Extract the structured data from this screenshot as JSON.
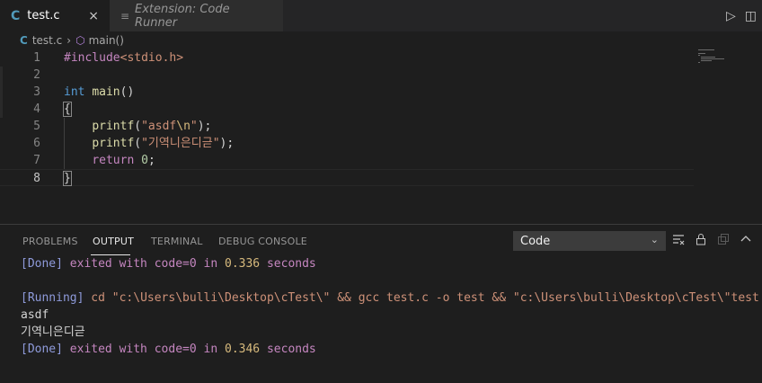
{
  "tabs": [
    {
      "label": "test.c",
      "icon": "c-file-icon",
      "icon_glyph": "C",
      "active": true,
      "close": "×"
    },
    {
      "label": "Extension: Code Runner",
      "icon": "preview-icon",
      "icon_glyph": "≡",
      "active": false
    }
  ],
  "tab_actions": {
    "run_glyph": "▷",
    "split_glyph": "◫"
  },
  "breadcrumb": {
    "file": "test.c",
    "file_glyph": "C",
    "symbol": "main()",
    "symbol_glyph": "⬡",
    "sep": "›"
  },
  "editor": {
    "line_numbers": [
      "1",
      "2",
      "3",
      "4",
      "5",
      "6",
      "7",
      "8"
    ],
    "lines": {
      "l1": {
        "pp": "#include",
        "hdr": "<stdio.h>"
      },
      "l3": {
        "kw": "int",
        "fn": "main",
        "rest": "()"
      },
      "l4": {
        "brace": "{"
      },
      "l5": {
        "indent": "    ",
        "fn": "printf",
        "open": "(",
        "str1": "\"asdf",
        "esc": "\\n",
        "str2": "\"",
        "close": ");"
      },
      "l6": {
        "indent": "    ",
        "fn": "printf",
        "open": "(",
        "str": "\"기역니은디귿\"",
        "close": ");"
      },
      "l7": {
        "indent": "    ",
        "kw": "return",
        "sp": " ",
        "num": "0",
        "end": ";"
      },
      "l8": {
        "brace": "}"
      }
    }
  },
  "panel": {
    "tabs": [
      "PROBLEMS",
      "OUTPUT",
      "TERMINAL",
      "DEBUG CONSOLE"
    ],
    "active_tab": "OUTPUT",
    "channel": "Code",
    "chev": "⌄",
    "acts": {
      "clear": "≡̶",
      "lock": "🔒︎",
      "copy": "⧉",
      "maximize": "^"
    },
    "output": {
      "done1": {
        "tag": "[Done]",
        "text": " exited with ",
        "code": "code=0",
        "in": " in ",
        "num": "0.336",
        "sec": " seconds"
      },
      "running": {
        "tag": "[Running]",
        "cmd": " cd \"c:\\Users\\bulli\\Desktop\\cTest\\\" && gcc test.c -o test && \"c:\\Users\\bulli\\Desktop\\cTest\\\"test"
      },
      "line_a": "asdf",
      "line_b": "기역니은디귿",
      "done2": {
        "tag": "[Done]",
        "text": " exited with ",
        "code": "code=0",
        "in": " in ",
        "num": "0.346",
        "sec": " seconds"
      }
    }
  }
}
